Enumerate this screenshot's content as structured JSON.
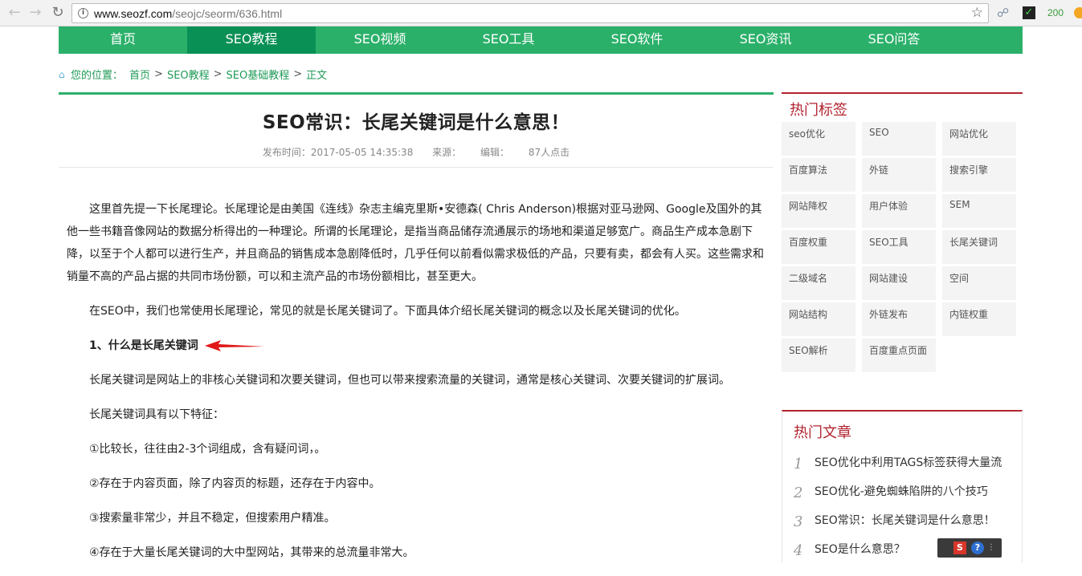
{
  "browser": {
    "url_host": "www.seozf.com",
    "url_path": "/seojc/seorm/636.html",
    "ext_count": "200"
  },
  "nav": [
    "首页",
    "SEO教程",
    "SEO视频",
    "SEO工具",
    "SEO软件",
    "SEO资讯",
    "SEO问答"
  ],
  "breadcrumb": {
    "prefix": "您的位置：",
    "items": [
      "首页",
      "SEO教程",
      "SEO基础教程",
      "正文"
    ],
    "sep": ">"
  },
  "article": {
    "title": "SEO常识：长尾关键词是什么意思！",
    "meta": {
      "time": "发布时间：2017-05-05 14:35:38",
      "source": "来源：",
      "editor": "编辑：",
      "clicks": "87人点击"
    },
    "paragraphs": [
      "这里首先提一下长尾理论。长尾理论是由美国《连线》杂志主编克里斯•安德森( Chris Anderson)根据对亚马逊网、Google及国外的其他一些书籍音像网站的数据分析得出的一种理论。所谓的长尾理论，是指当商品储存流通展示的场地和渠道足够宽广。商品生产成本急剧下降，以至于个人都可以进行生产，并且商品的销售成本急剧降低时，几乎任何以前看似需求极低的产品，只要有卖，都会有人买。这些需求和销量不高的产品占据的共同市场份额，可以和主流产品的市场份额相比，甚至更大。",
      "在SEO中，我们也常使用长尾理论，常见的就是长尾关键词了。下面具体介绍长尾关键词的概念以及长尾关键词的优化。"
    ],
    "heading1": "1、什么是长尾关键词",
    "paragraphs2": [
      "长尾关键词是网站上的非核心关键词和次要关键词，但也可以带来搜索流量的关键词，通常是核心关键词、次要关键词的扩展词。",
      "长尾关键词具有以下特征：",
      "①比较长，往往由2-3个词组成，含有疑问词，。",
      "②存在于内容页面，除了内容页的标题，还存在于内容中。",
      "③搜索量非常少，并且不稳定，但搜索用户精准。",
      "④存在于大量长尾关键词的大中型网站，其带来的总流量非常大。"
    ]
  },
  "sidebar": {
    "tags_title": "热门标签",
    "tags": [
      "seo优化",
      "SEO",
      "网站优化",
      "百度算法",
      "外链",
      "搜索引擎",
      "网站降权",
      "用户体验",
      "SEM",
      "百度权重",
      "SEO工具",
      "长尾关键词",
      "二级域名",
      "网站建设",
      "空间",
      "网站结构",
      "外链发布",
      "内链权重",
      "SEO解析",
      "百度重点页面"
    ],
    "hot_title": "热门文章",
    "hot": [
      {
        "num": "1",
        "title": "SEO优化中利用TAGS标签获得大量流"
      },
      {
        "num": "2",
        "title": "SEO优化-避免蜘蛛陷阱的八个技巧"
      },
      {
        "num": "3",
        "title": "SEO常识：长尾关键词是什么意思！"
      },
      {
        "num": "4",
        "title": "SEO是什么意思？"
      }
    ]
  },
  "colors": {
    "nav_green": "#2bb06a",
    "nav_active": "#099055",
    "side_red": "#b22430"
  }
}
